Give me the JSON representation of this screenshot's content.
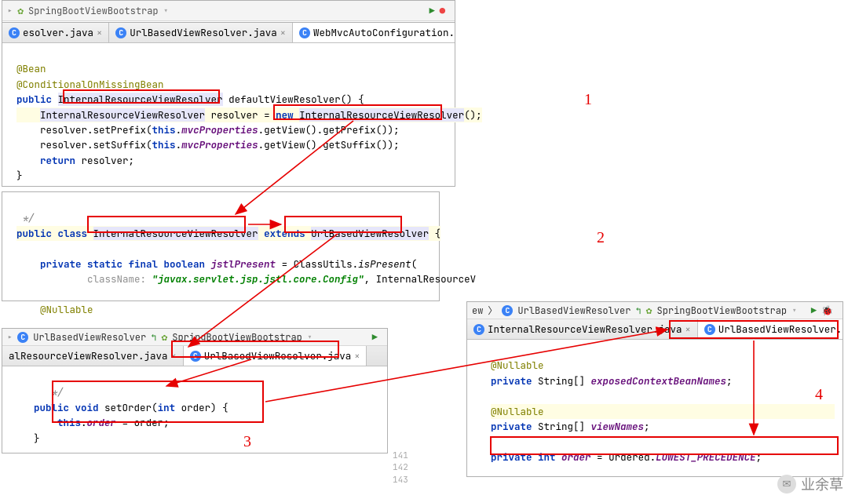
{
  "panel1": {
    "tabs": [
      "esolver.java",
      "UrlBasedViewResolver.java",
      "WebMvcAutoConfiguration.java"
    ],
    "activeTab": 2,
    "code": {
      "ann1": "@Bean",
      "ann2": "@ConditionalOnMissingBean",
      "type1": "InternalResourceViewResolver",
      "methodName": "defaultViewResolver",
      "varName": "resolver",
      "newType": "InternalResourceViewResolver",
      "field": "mvcProperties",
      "setPrefix": "setPrefix",
      "setSuffix": "setSuffix",
      "getView": "getView",
      "getPrefix": "getPrefix",
      "getSuffix": "getSuffix",
      "ret": "return"
    }
  },
  "panel2": {
    "className": "InternalResourceViewResolver",
    "extendsName": "UrlBasedViewResolver",
    "fieldName": "jstlPresent",
    "classUtils": "ClassUtils",
    "isPresent": "isPresent",
    "paramLabel": "className:",
    "strVal": "\"javax.servlet.jsp.jstl.core.Config\"",
    "trail": ", InternalResourceV",
    "nullable": "@Nullable"
  },
  "panel3": {
    "tabs_partial_top": [
      "UrlBasedViewResolver",
      "SpringBootViewBootstrap"
    ],
    "tabs": [
      "alResourceViewResolver.java",
      "UrlBasedViewResolver.java"
    ],
    "activeTab": 1,
    "method": "setOrder",
    "param": "order",
    "thisField": "order"
  },
  "panel4": {
    "breadcrumbItems": [
      "ew",
      "UrlBasedViewResolver",
      "SpringBootViewBootstrap"
    ],
    "tabs": [
      "InternalResourceViewResolver.java",
      "UrlBasedViewResolver.java"
    ],
    "activeTab": 1,
    "nullable": "@Nullable",
    "line1_name": "exposedContextBeanNames",
    "line2_name": "viewNames",
    "orderField": "order",
    "ordered": "Ordered",
    "lowest": "LOWEST_PRECEDENCE"
  },
  "annotNums": [
    "1",
    "2",
    "3",
    "4"
  ],
  "watermark": "业余草",
  "lineNums": [
    "141",
    "142",
    "143"
  ]
}
